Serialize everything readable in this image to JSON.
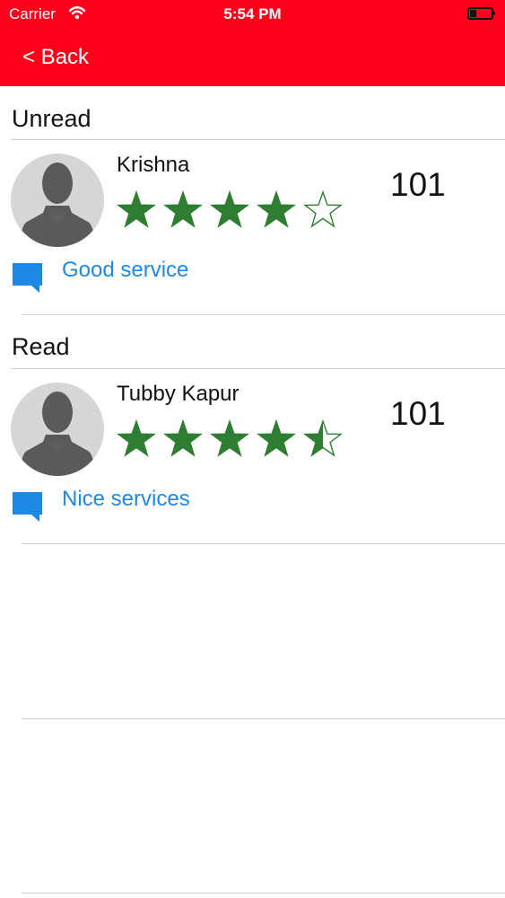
{
  "status_bar": {
    "carrier": "Carrier",
    "time": "5:54 PM",
    "wifi_icon": "wifi-icon",
    "battery_icon": "battery-icon"
  },
  "nav": {
    "back_label": "< Back",
    "background_color": "#ff001a"
  },
  "sections": [
    {
      "title": "Unread",
      "reviews": [
        {
          "name": "Krishna",
          "rating": 4,
          "score": "101",
          "comment": "Good service"
        }
      ]
    },
    {
      "title": "Read",
      "reviews": [
        {
          "name": "Tubby Kapur",
          "rating": 4.5,
          "score": "101",
          "comment": "Nice services"
        }
      ]
    }
  ],
  "colors": {
    "star": "#2e7d32",
    "comment": "#1e88e5",
    "divider": "#cfcfcf"
  },
  "icons": {
    "avatar": "user-avatar-icon",
    "comment": "comment-icon",
    "star": "star-icon"
  }
}
